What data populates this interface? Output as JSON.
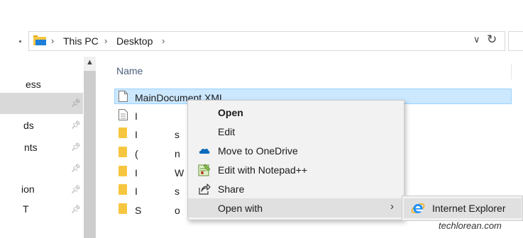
{
  "address_bar": {
    "segments": [
      "This PC",
      "Desktop"
    ],
    "separator": "›"
  },
  "nav_pane": {
    "items": [
      {
        "label": "ess"
      },
      {
        "label": "ds"
      },
      {
        "label": "nts"
      },
      {
        "label": "ion"
      },
      {
        "label": "T"
      }
    ]
  },
  "file_list": {
    "column_name": "Name",
    "selected_file": "MainDocument.XML",
    "row_fragments": [
      "I",
      "I",
      "(",
      "I",
      "I",
      "S"
    ],
    "right_fragments": [
      "",
      "s",
      "n",
      "W",
      "s",
      "o"
    ]
  },
  "context_menu": {
    "items": [
      {
        "label": "Open",
        "icon": "",
        "bold": true
      },
      {
        "label": "Edit",
        "icon": ""
      },
      {
        "label": "Move to OneDrive",
        "icon": "onedrive-cloud-icon"
      },
      {
        "label": "Edit with Notepad++",
        "icon": "notepad-plus-plus-icon"
      },
      {
        "label": "Share",
        "icon": "share-icon"
      },
      {
        "label": "Open with",
        "icon": "",
        "submenu": true
      }
    ]
  },
  "submenu": {
    "items": [
      {
        "label": "Internet Explorer",
        "icon": "internet-explorer-icon"
      }
    ]
  },
  "watermark": "techlorean.com",
  "colors": {
    "selection": "#cce8ff",
    "menu_bg": "#f2f2f2",
    "menu_hover": "#e0e0e0",
    "folder": "#f7c640",
    "onedrive": "#0f6cbd",
    "ie_blue": "#1e90ff"
  }
}
